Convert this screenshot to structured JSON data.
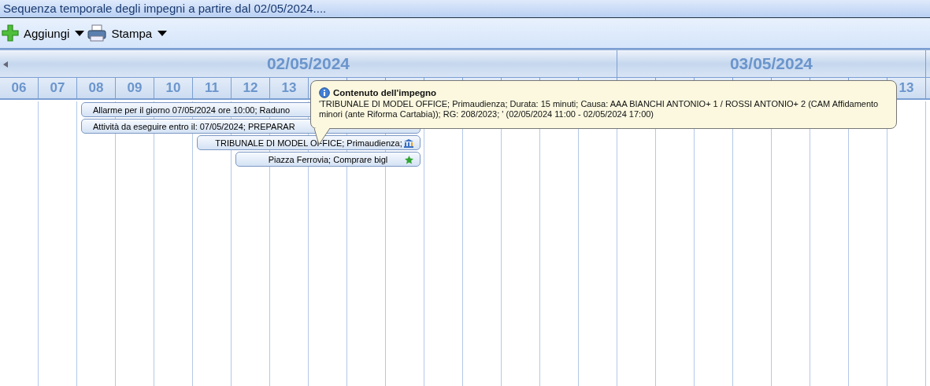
{
  "window": {
    "title": "Sequenza temporale degli impegni a partire dal 02/05/2024...."
  },
  "toolbar": [
    {
      "label": "Aggiungi",
      "kind": "add"
    },
    {
      "label": "Stampa",
      "kind": "print"
    }
  ],
  "days": [
    {
      "label": "02/05/2024",
      "hours": [
        "06",
        "07",
        "08",
        "09",
        "10",
        "11",
        "12",
        "13"
      ]
    },
    {
      "label": "03/05/2024",
      "hours": [
        "13"
      ]
    }
  ],
  "events": [
    {
      "text": "Allarme per il giorno 07/05/2024 ore 10:00; Raduno",
      "kind": "plain"
    },
    {
      "text": "Attività da eseguire entro il: 07/05/2024; PREPARAR",
      "kind": "plain"
    },
    {
      "text": "TRIBUNALE DI MODEL OFFICE; Primaudienza;",
      "kind": "court"
    },
    {
      "text": "Piazza Ferrovia; Comprare bigl",
      "kind": "star"
    }
  ],
  "tooltip": {
    "title": "Contenuto dell'impegno",
    "text": "'TRIBUNALE DI MODEL OFFICE; Primaudienza; Durata: 15 minuti; Causa: AAA BIANCHI ANTONIO+ 1 / ROSSI ANTONIO+ 2 (CAM Affidamento minori (ante Riforma Cartabia));  RG: 208/2023; ' (02/05/2024 11:00 - 02/05/2024 17:00)"
  }
}
